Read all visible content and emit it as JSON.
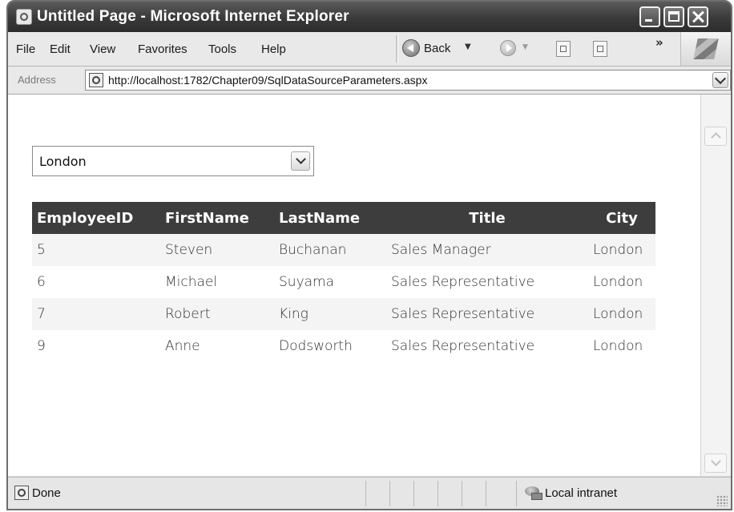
{
  "window": {
    "title": "Untitled Page - Microsoft Internet Explorer"
  },
  "menu": {
    "items": [
      "File",
      "Edit",
      "View",
      "Favorites",
      "Tools",
      "Help"
    ]
  },
  "toolbar": {
    "back_label": "Back",
    "back_dropdown": "▼",
    "forward_dropdown": "▼",
    "more_label": "»",
    "icons": [
      "back-arrow-icon",
      "forward-arrow-icon",
      "stop-icon",
      "refresh-icon"
    ]
  },
  "address": {
    "label": "Address",
    "url": "http://localhost:1782/Chapter09/SqlDataSourceParameters.aspx"
  },
  "page": {
    "city_select": {
      "selected": "London"
    },
    "grid": {
      "columns": [
        "EmployeeID",
        "FirstName",
        "LastName",
        "Title",
        "City"
      ],
      "rows": [
        [
          "5",
          "Steven",
          "Buchanan",
          "Sales Manager",
          "London"
        ],
        [
          "6",
          "Michael",
          "Suyama",
          "Sales Representative",
          "London"
        ],
        [
          "7",
          "Robert",
          "King",
          "Sales Representative",
          "London"
        ],
        [
          "9",
          "Anne",
          "Dodsworth",
          "Sales Representative",
          "London"
        ]
      ]
    }
  },
  "status": {
    "text": "Done",
    "zone": "Local intranet"
  },
  "colors": {
    "titlebar": "#3a3a3a",
    "grid_header": "#3d3d3d",
    "grid_alt_row": "#f4f4f4"
  }
}
